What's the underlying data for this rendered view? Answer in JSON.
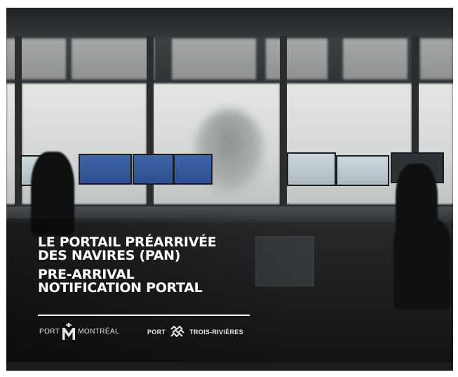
{
  "title": {
    "fr": "LE PORTAIL PRÉARRIVÉE\nDES NAVIRES (PAN)",
    "en": "PRE-ARRIVAL\nNOTIFICATION PORTAL"
  },
  "logos": {
    "montreal": {
      "prefix": "PORT",
      "name": "MONTRÉAL",
      "icon": "port-montreal-m-icon"
    },
    "trois_rivieres": {
      "prefix": "PORT",
      "name": "TROIS-RIVIÈRES",
      "icon": "port-trois-rivieres-waves-icon"
    }
  },
  "colors": {
    "overlay_text": "#ffffff",
    "rule": "#f2f2f2"
  }
}
